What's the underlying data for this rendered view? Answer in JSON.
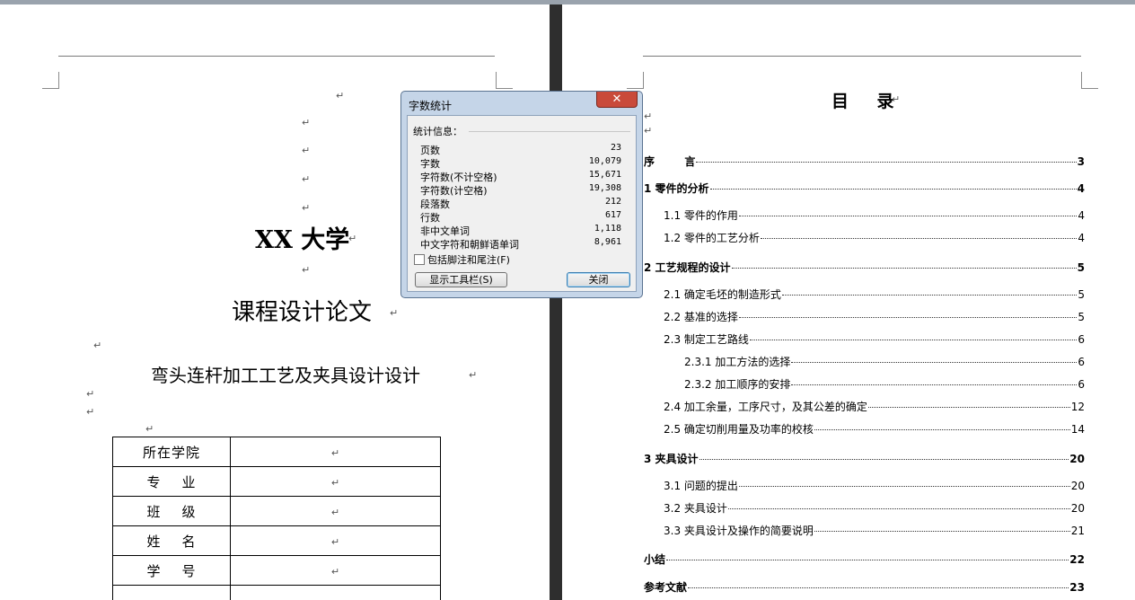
{
  "cover": {
    "university": "XX 大学",
    "course": "课程设计论文",
    "subject": "弯头连杆加工工艺及夹具设计设计",
    "info_table": [
      {
        "label": "所在学院",
        "value": ""
      },
      {
        "label": "专    业",
        "value": ""
      },
      {
        "label": "班    级",
        "value": ""
      },
      {
        "label": "姓    名",
        "value": ""
      },
      {
        "label": "学    号",
        "value": ""
      }
    ]
  },
  "toc": {
    "title": "目    录",
    "entries": [
      {
        "text": "序        言",
        "page": "3",
        "level": 0
      },
      {
        "text": "1 零件的分析",
        "page": "4",
        "level": 0
      },
      {
        "text": "1.1 零件的作用",
        "page": "4",
        "level": 1
      },
      {
        "text": "1.2 零件的工艺分析",
        "page": "4",
        "level": 1
      },
      {
        "text": "2 工艺规程的设计",
        "page": "5",
        "level": 0
      },
      {
        "text": "2.1 确定毛坯的制造形式",
        "page": "5",
        "level": 1
      },
      {
        "text": "2.2 基准的选择",
        "page": "5",
        "level": 1
      },
      {
        "text": "2.3 制定工艺路线",
        "page": "6",
        "level": 1
      },
      {
        "text": "2.3.1 加工方法的选择",
        "page": "6",
        "level": 2
      },
      {
        "text": "2.3.2 加工顺序的安排",
        "page": "6",
        "level": 2
      },
      {
        "text": "2.4 加工余量，工序尺寸，及其公差的确定",
        "page": "12",
        "level": 1
      },
      {
        "text": "2.5 确定切削用量及功率的校核",
        "page": "14",
        "level": 1
      },
      {
        "text": "3 夹具设计",
        "page": "20",
        "level": 0
      },
      {
        "text": "3.1 问题的提出",
        "page": "20",
        "level": 1
      },
      {
        "text": "3.2 夹具设计",
        "page": "20",
        "level": 1
      },
      {
        "text": "3.3 夹具设计及操作的简要说明",
        "page": "21",
        "level": 1
      },
      {
        "text": "小结",
        "page": "22",
        "level": 0
      },
      {
        "text": "参考文献",
        "page": "23",
        "level": 0
      }
    ]
  },
  "dialog": {
    "title": "字数统计",
    "close_glyph": "✕",
    "stats_header": "统计信息：",
    "stats": [
      {
        "label": "页数",
        "value": "23"
      },
      {
        "label": "字数",
        "value": "10,079"
      },
      {
        "label": "字符数(不计空格)",
        "value": "15,671"
      },
      {
        "label": "字符数(计空格)",
        "value": "19,308"
      },
      {
        "label": "段落数",
        "value": "212"
      },
      {
        "label": "行数",
        "value": "617"
      },
      {
        "label": "非中文单词",
        "value": "1,118"
      },
      {
        "label": "中文字符和朝鲜语单词",
        "value": "8,961"
      }
    ],
    "include_footnotes_label": "包括脚注和尾注(F)",
    "show_toolbar_button": "显示工具栏(S)",
    "close_button": "关闭"
  },
  "para_mark": "↵"
}
